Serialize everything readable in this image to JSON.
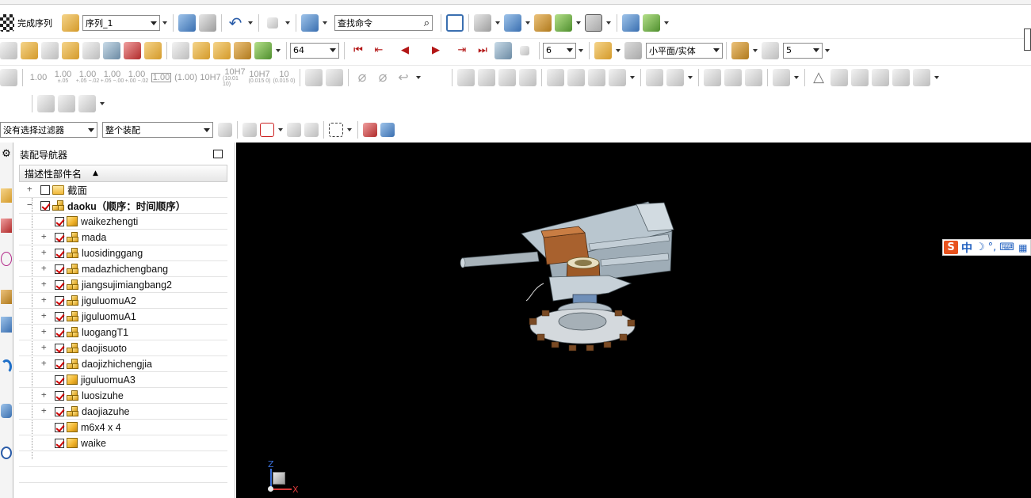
{
  "toolbar1": {
    "finish_sequence": "完成序列",
    "sequence_select": "序列_1",
    "command_finder_placeholder": "查找命令"
  },
  "toolbar2": {
    "step_value": "64",
    "playback_speed": "6",
    "selection_scope": "小平面/实体",
    "count_value": "5"
  },
  "toolbar3": {
    "tolerances": [
      {
        "main": "1.00",
        "sub": ""
      },
      {
        "main": "1.00",
        "sub": "±.05"
      },
      {
        "main": "1.00",
        "sub": "+.05 −.02"
      },
      {
        "main": "1.00",
        "sub": "+.05 −.00"
      },
      {
        "main": "1.00",
        "sub": "+.00 −.02"
      },
      {
        "main": "1.00",
        "sub": "boxed"
      },
      {
        "main": "(1.00)",
        "sub": ""
      },
      {
        "main": "10H7",
        "sub": ""
      },
      {
        "main": "10H7",
        "sub": "(10.01 10)"
      },
      {
        "main": "10H7",
        "sub": "(0.015 0)"
      },
      {
        "main": "10",
        "sub": "(0.015 0)"
      }
    ]
  },
  "filters": {
    "selection_filter": "没有选择过滤器",
    "scope": "整个装配"
  },
  "navigator": {
    "title": "装配导航器",
    "column_header": "描述性部件名",
    "items": [
      {
        "label": "截面",
        "type": "folder",
        "level": 0,
        "expand": "+",
        "checked": false
      },
      {
        "label": "daoku（顺序：时间顺序）",
        "type": "assembly",
        "level": 0,
        "expand": "−",
        "checked": true,
        "bold": true
      },
      {
        "label": "waikezhengti",
        "type": "part",
        "level": 1,
        "expand": "",
        "checked": true
      },
      {
        "label": "mada",
        "type": "assembly",
        "level": 1,
        "expand": "+",
        "checked": true
      },
      {
        "label": "luosidinggang",
        "type": "assembly",
        "level": 1,
        "expand": "+",
        "checked": true
      },
      {
        "label": "madazhichengbang",
        "type": "assembly",
        "level": 1,
        "expand": "+",
        "checked": true
      },
      {
        "label": "jiangsujimiangbang2",
        "type": "assembly",
        "level": 1,
        "expand": "+",
        "checked": true
      },
      {
        "label": "jiguluomuA2",
        "type": "assembly",
        "level": 1,
        "expand": "+",
        "checked": true
      },
      {
        "label": "jiguluomuA1",
        "type": "assembly",
        "level": 1,
        "expand": "+",
        "checked": true
      },
      {
        "label": "luogangT1",
        "type": "assembly",
        "level": 1,
        "expand": "+",
        "checked": true
      },
      {
        "label": "daojisuoto",
        "type": "assembly",
        "level": 1,
        "expand": "+",
        "checked": true
      },
      {
        "label": "daojizhichengjia",
        "type": "assembly",
        "level": 1,
        "expand": "+",
        "checked": true
      },
      {
        "label": "jiguluomuA3",
        "type": "part",
        "level": 1,
        "expand": "",
        "checked": true
      },
      {
        "label": "luosizuhe",
        "type": "assembly",
        "level": 1,
        "expand": "+",
        "checked": true
      },
      {
        "label": "daojiazuhe",
        "type": "assembly",
        "level": 1,
        "expand": "+",
        "checked": true
      },
      {
        "label": "m6x4 x 4",
        "type": "part",
        "level": 1,
        "expand": "",
        "checked": true
      },
      {
        "label": "waike",
        "type": "part",
        "level": 1,
        "expand": "",
        "checked": true
      }
    ]
  },
  "viewport": {
    "triad_z": "Z",
    "triad_x": "X"
  },
  "ime": {
    "mode": "中"
  }
}
